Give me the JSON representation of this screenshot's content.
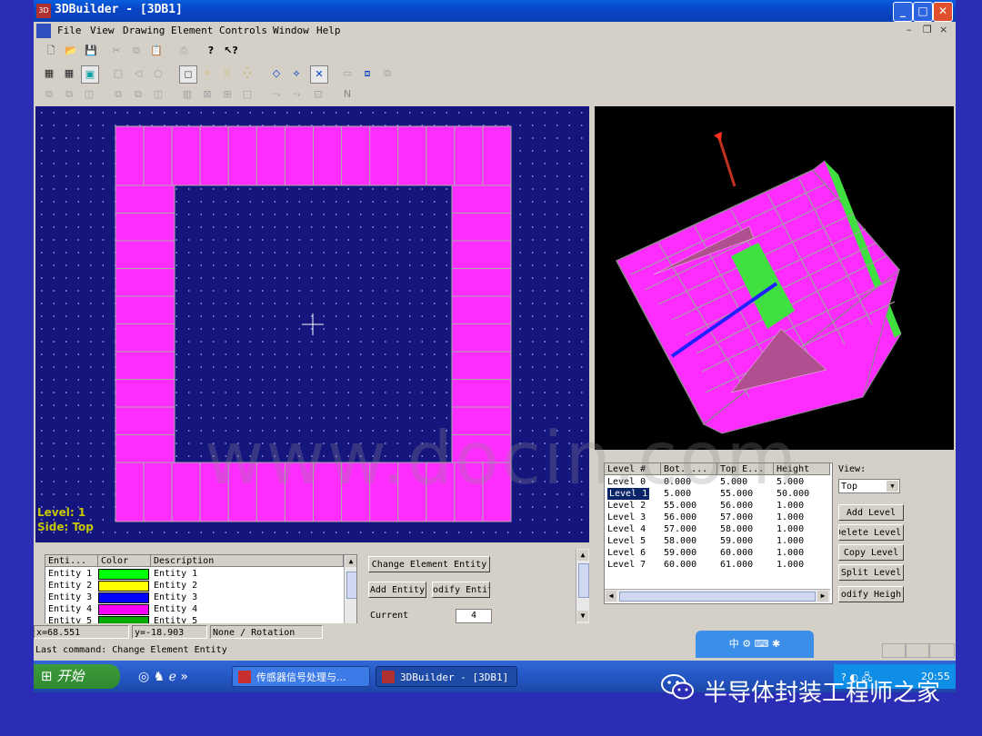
{
  "window": {
    "title": "3DBuilder - [3DB1]",
    "app_icon": "3D",
    "controls": {
      "minimize": "_",
      "maximize": "□",
      "close": "✕"
    },
    "mdi_controls": {
      "minimize": "–",
      "restore": "❐",
      "close": "×"
    }
  },
  "menu": [
    "File",
    "View",
    "Drawing",
    "Element",
    "Controls",
    "Window",
    "Help"
  ],
  "toolbar1": [
    "new-icon",
    "open-icon",
    "save-icon",
    "cut-icon",
    "copy-icon",
    "paste-icon",
    "print-icon",
    "help-icon",
    "context-help-icon"
  ],
  "toolbar2": [
    "grid-icon",
    "grid2-icon",
    "grid3-icon",
    "rect-icon",
    "shape-icon",
    "circle-icon",
    "select-icon",
    "point-icon",
    "snap-icon",
    "zoom-icon",
    "move-icon",
    "rotate-icon",
    "cross-icon",
    "box-icon",
    "layer-icon",
    "view-icon"
  ],
  "toolbar3_last": "N",
  "view2d": {
    "level": "Level: 1",
    "side": "Side: Top",
    "watermark": "www.docin.com"
  },
  "entities": {
    "headers": [
      "Enti...",
      "Color",
      "Description"
    ],
    "rows": [
      {
        "name": "Entity 1",
        "color": "#00ff00",
        "desc": "Entity 1"
      },
      {
        "name": "Entity 2",
        "color": "#ffff00",
        "desc": "Entity 2"
      },
      {
        "name": "Entity 3",
        "color": "#0000ff",
        "desc": "Entity 3"
      },
      {
        "name": "Entity 4",
        "color": "#ff00ff",
        "desc": "Entity 4"
      },
      {
        "name": "Entity 5",
        "color": "#00aa00",
        "desc": "Entity 5"
      }
    ]
  },
  "entity_buttons": {
    "change": "Change Element Entity",
    "add": "Add Entity",
    "modify": "odify Entit",
    "current_label": "Current",
    "current_value": "4"
  },
  "levels": {
    "headers": [
      "Level #",
      "Bot. ...",
      "Top E...",
      "Height"
    ],
    "rows": [
      {
        "level": "Level 0",
        "bot": "0.000",
        "top": "5.000",
        "height": "5.000"
      },
      {
        "level": "Level 1",
        "bot": "5.000",
        "top": "55.000",
        "height": "50.000"
      },
      {
        "level": "Level 2",
        "bot": "55.000",
        "top": "56.000",
        "height": "1.000"
      },
      {
        "level": "Level 3",
        "bot": "56.000",
        "top": "57.000",
        "height": "1.000"
      },
      {
        "level": "Level 4",
        "bot": "57.000",
        "top": "58.000",
        "height": "1.000"
      },
      {
        "level": "Level 5",
        "bot": "58.000",
        "top": "59.000",
        "height": "1.000"
      },
      {
        "level": "Level 6",
        "bot": "59.000",
        "top": "60.000",
        "height": "1.000"
      },
      {
        "level": "Level 7",
        "bot": "60.000",
        "top": "61.000",
        "height": "1.000"
      }
    ],
    "selected_index": 1
  },
  "view_panel": {
    "label": "View:",
    "selected": "Top",
    "add": "Add Level",
    "delete": "Delete Level",
    "copy": "Copy Level",
    "split": "Split Level",
    "modify": "odify Heigh"
  },
  "status": {
    "x": "x=68.551",
    "y": "y=-18.903",
    "mode": "None / Rotation",
    "last_command": "Last command: Change Element Entity"
  },
  "taskbar": {
    "start": "开始",
    "task1": "传感器信号处理与...",
    "task2": "3DBuilder - [3DB1]",
    "time": "20:55",
    "ime": "中"
  },
  "footer": "半导体封装工程师之家"
}
